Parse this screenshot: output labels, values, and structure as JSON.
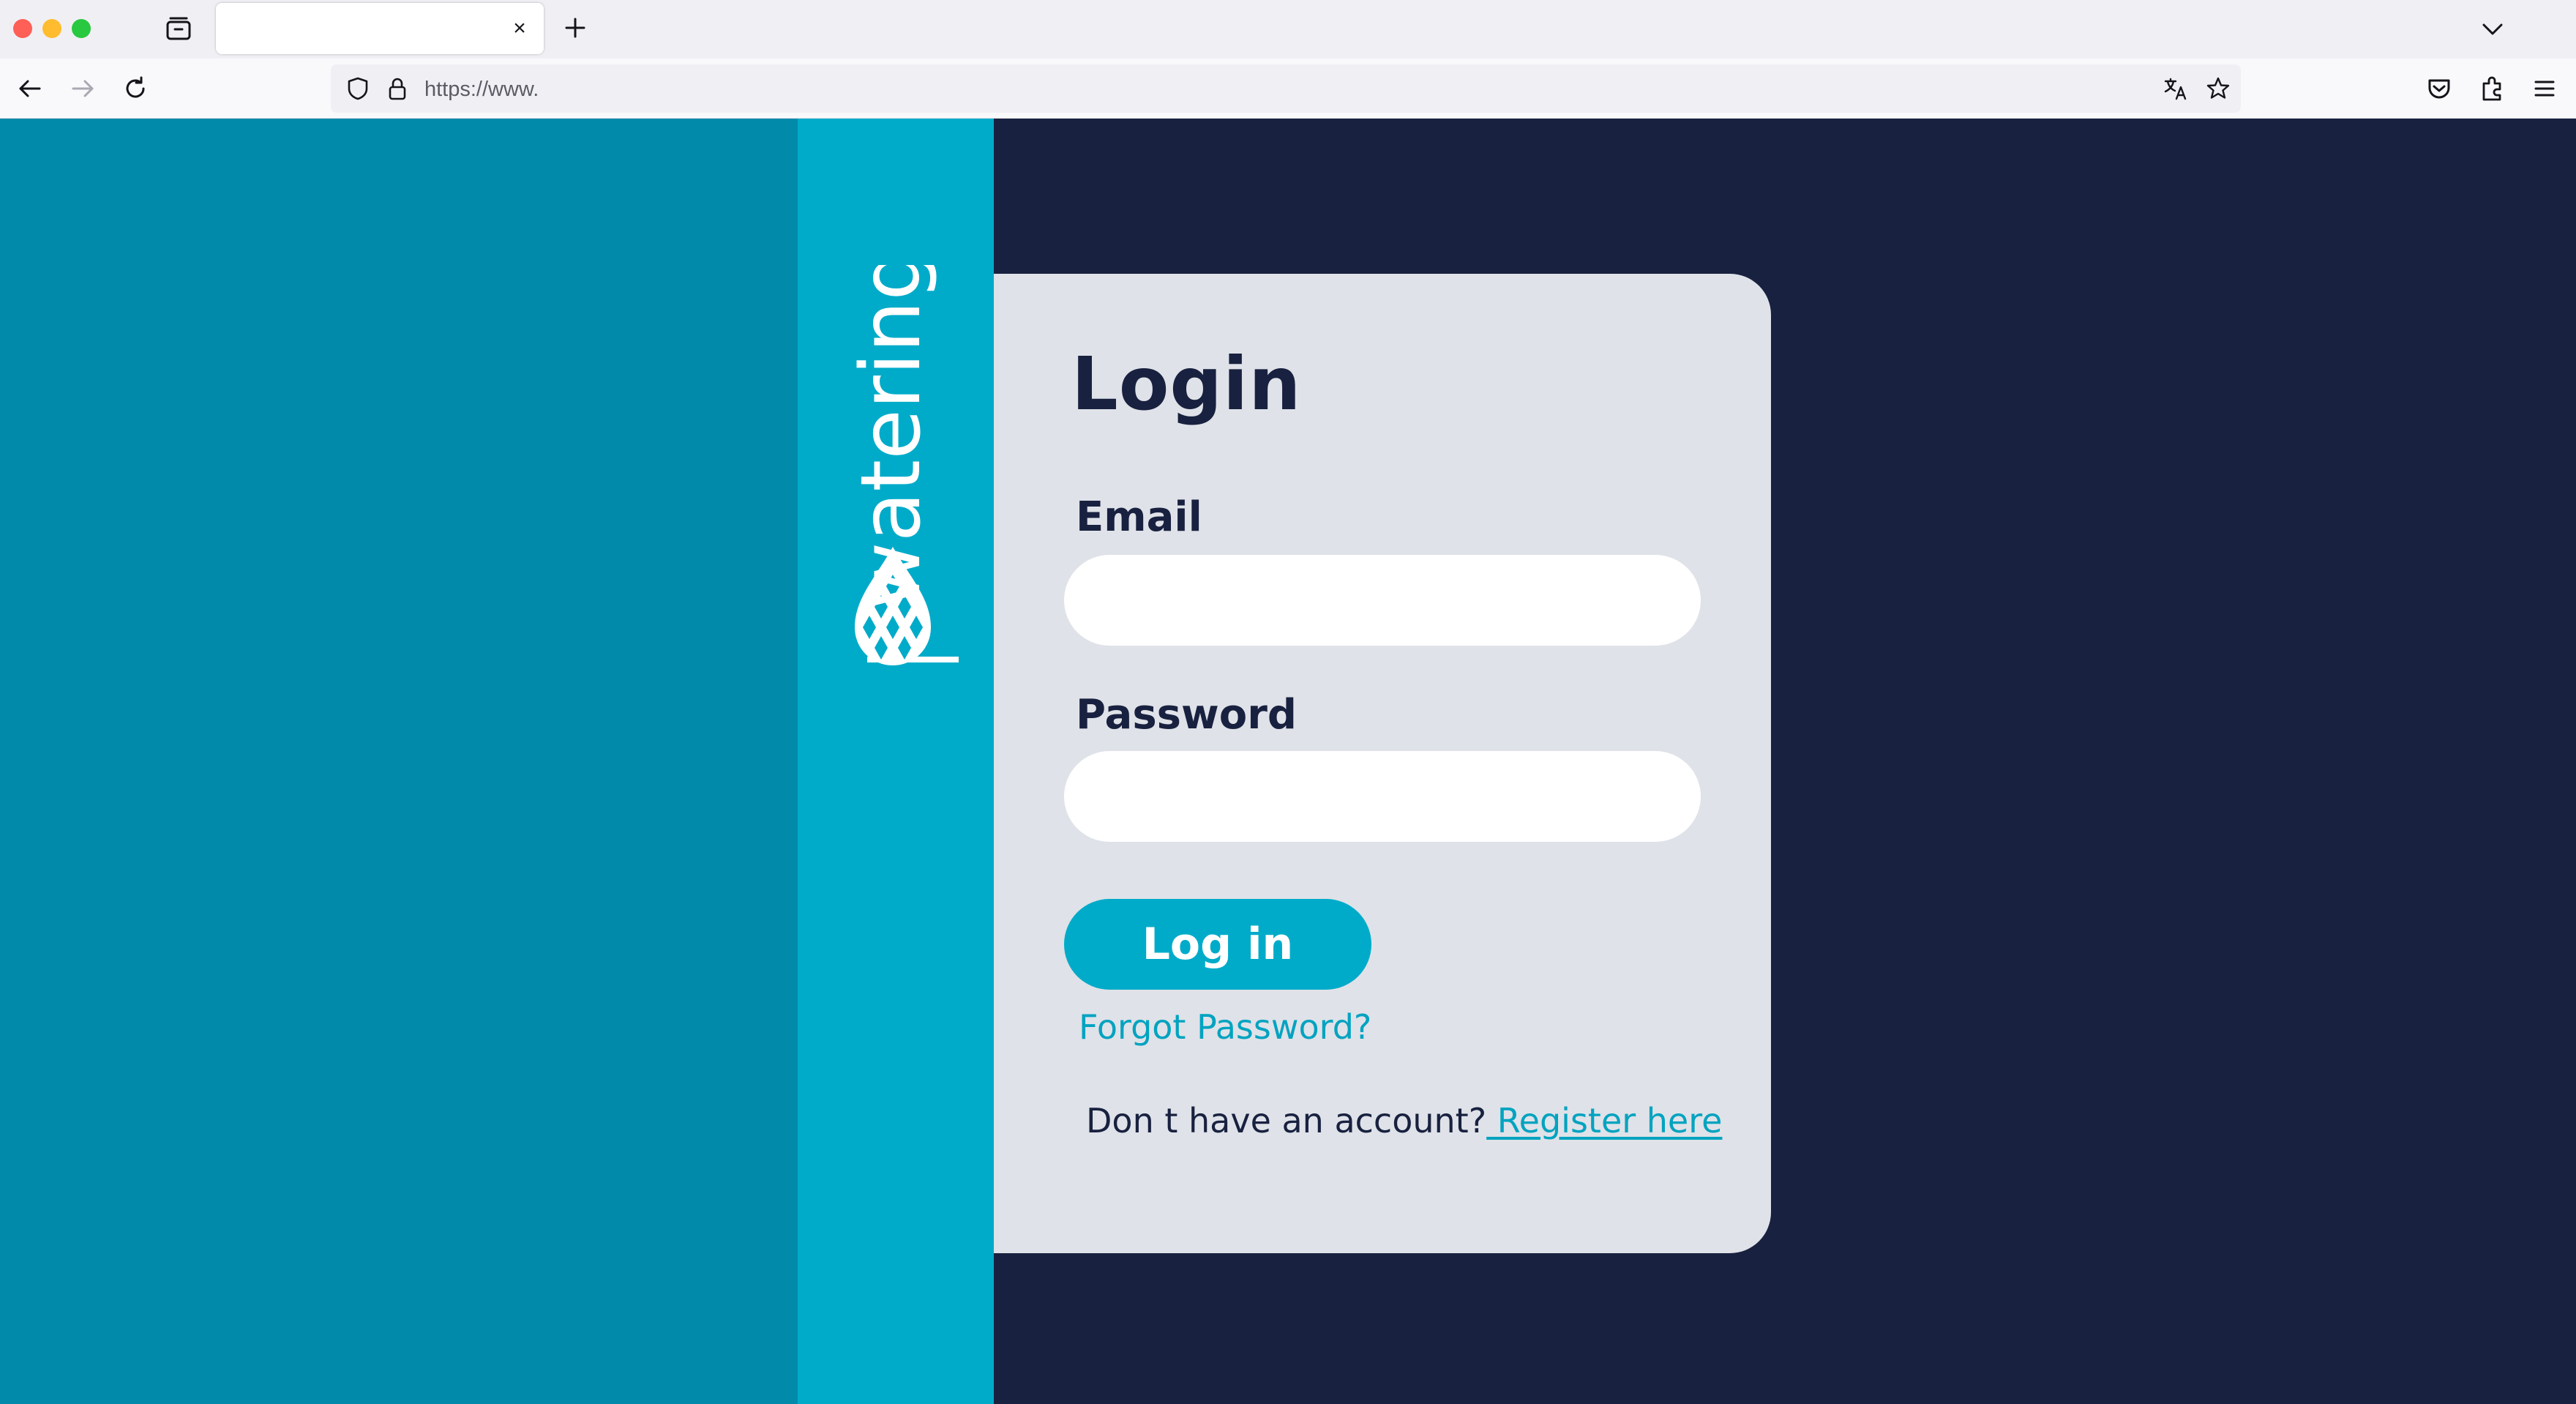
{
  "browser": {
    "tab_title": "",
    "tab_close_glyph": "×",
    "url": "https://www.",
    "icons": [
      "tabs-overview-icon",
      "close-icon",
      "plus-icon",
      "chevron-down-icon",
      "back-arrow-icon",
      "forward-arrow-icon",
      "reload-icon",
      "shield-icon",
      "lock-icon",
      "translate-icon",
      "bookmark-star-icon",
      "pocket-icon",
      "extensions-icon",
      "hamburger-menu-icon"
    ]
  },
  "brand": {
    "wordmark": "watering",
    "logo_icon": "water-drop-logo-icon",
    "color_strip": "#00abc9",
    "color_left": "#028aaa",
    "color_bg": "#18213f"
  },
  "login": {
    "title": "Login",
    "email_label": "Email",
    "email_value": "",
    "password_label": "Password",
    "password_value": "",
    "submit_label": "Log in",
    "forgot_label": "Forgot Password?",
    "register_prompt": "Don t have an account?",
    "register_link": " Register here",
    "accent": "#00abc9"
  }
}
